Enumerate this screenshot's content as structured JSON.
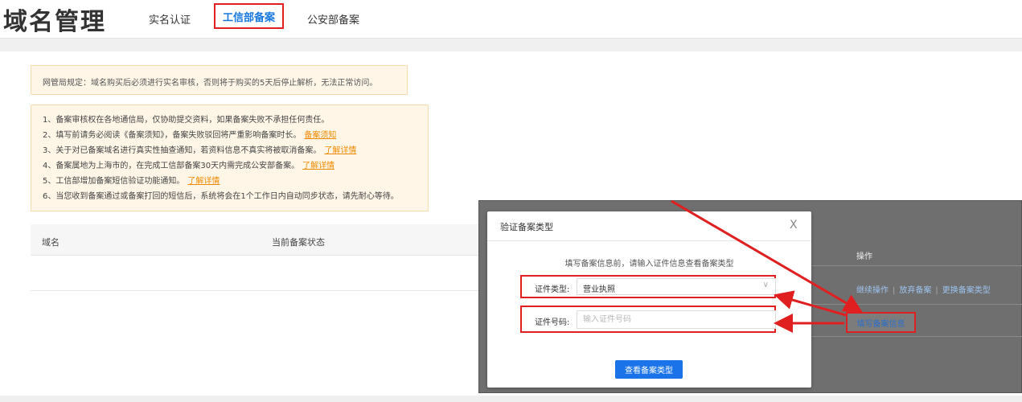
{
  "header": {
    "title": "域名管理",
    "tabs": [
      {
        "label": "实名认证"
      },
      {
        "label": "工信部备案"
      },
      {
        "label": "公安部备案"
      }
    ]
  },
  "notice": "网管局规定：域名购买后必须进行实名审核，否则将于购买的5天后停止解析，无法正常访问。",
  "rules": [
    {
      "text": "1、备案审核权在各地通信局，仅协助提交资料，如果备案失败不承担任何责任。",
      "link": ""
    },
    {
      "text": "2、填写前请务必阅读《备案须知》，备案失败驳回将严重影响备案时长。",
      "link": "备案须知"
    },
    {
      "text": "3、关于对已备案域名进行真实性抽查通知，若资料信息不真实将被取消备案。",
      "link": "了解详情"
    },
    {
      "text": "4、备案属地为上海市的，在完成工信部备案30天内需完成公安部备案。",
      "link": "了解详情"
    },
    {
      "text": "5、工信部增加备案短信验证功能通知。",
      "link": "了解详情"
    },
    {
      "text": "6、当您收到备案通过或备案打回的短信后，系统将会在1个工作日内自动同步状态，请先耐心等待。",
      "link": ""
    }
  ],
  "table": {
    "col_domain": "域名",
    "col_status": "当前备案状态",
    "col_ops": "操作"
  },
  "row_actions": {
    "continue": "继续操作",
    "abandon": "放弃备案",
    "change_type": "更换备案类型",
    "fill_info": "填写备案信息"
  },
  "modal": {
    "title": "验证备案类型",
    "close": "X",
    "tip": "填写备案信息前，请输入证件信息查看备案类型",
    "cert_type_label": "证件类型:",
    "cert_type_value": "营业执照",
    "cert_no_label": "证件号码:",
    "cert_no_placeholder": "输入证件号码",
    "cert_no_value": "",
    "submit": "查看备案类型"
  },
  "colors": {
    "accent": "#1a73e8",
    "highlight_red": "#e02020",
    "warning_bg": "#fff6e8",
    "link_orange": "#f08a00"
  }
}
